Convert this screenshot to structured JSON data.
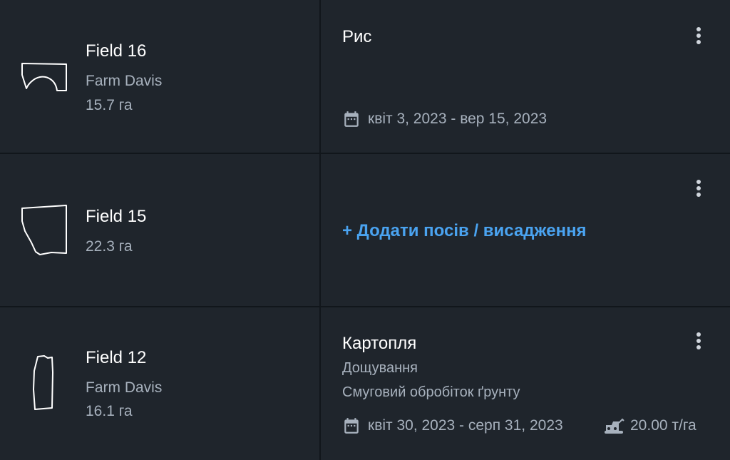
{
  "fields": [
    {
      "name": "Field 16",
      "farm": "Farm Davis",
      "area": "15.7 га",
      "crop": "Рис",
      "dates": "квіт 3, 2023 - вер 15, 2023"
    },
    {
      "name": "Field 15",
      "area": "22.3 га",
      "add_label": "+ Додати посів / висадження"
    },
    {
      "name": "Field 12",
      "farm": "Farm Davis",
      "area": "16.1 га",
      "crop": "Картопля",
      "operation_1": "Дощування",
      "operation_2": "Смуговий обробіток ґрунту",
      "dates": "квіт 30, 2023 - серп 31, 2023",
      "yield": "20.00 т/га"
    }
  ],
  "icons": {
    "calendar": "calendar-icon",
    "menu": "more-vertical-icon",
    "yield": "harvester-icon"
  },
  "colors": {
    "background": "#1f252c",
    "divider": "#11161b",
    "muted_text": "#a7b1bd",
    "link": "#4aa3f0"
  }
}
